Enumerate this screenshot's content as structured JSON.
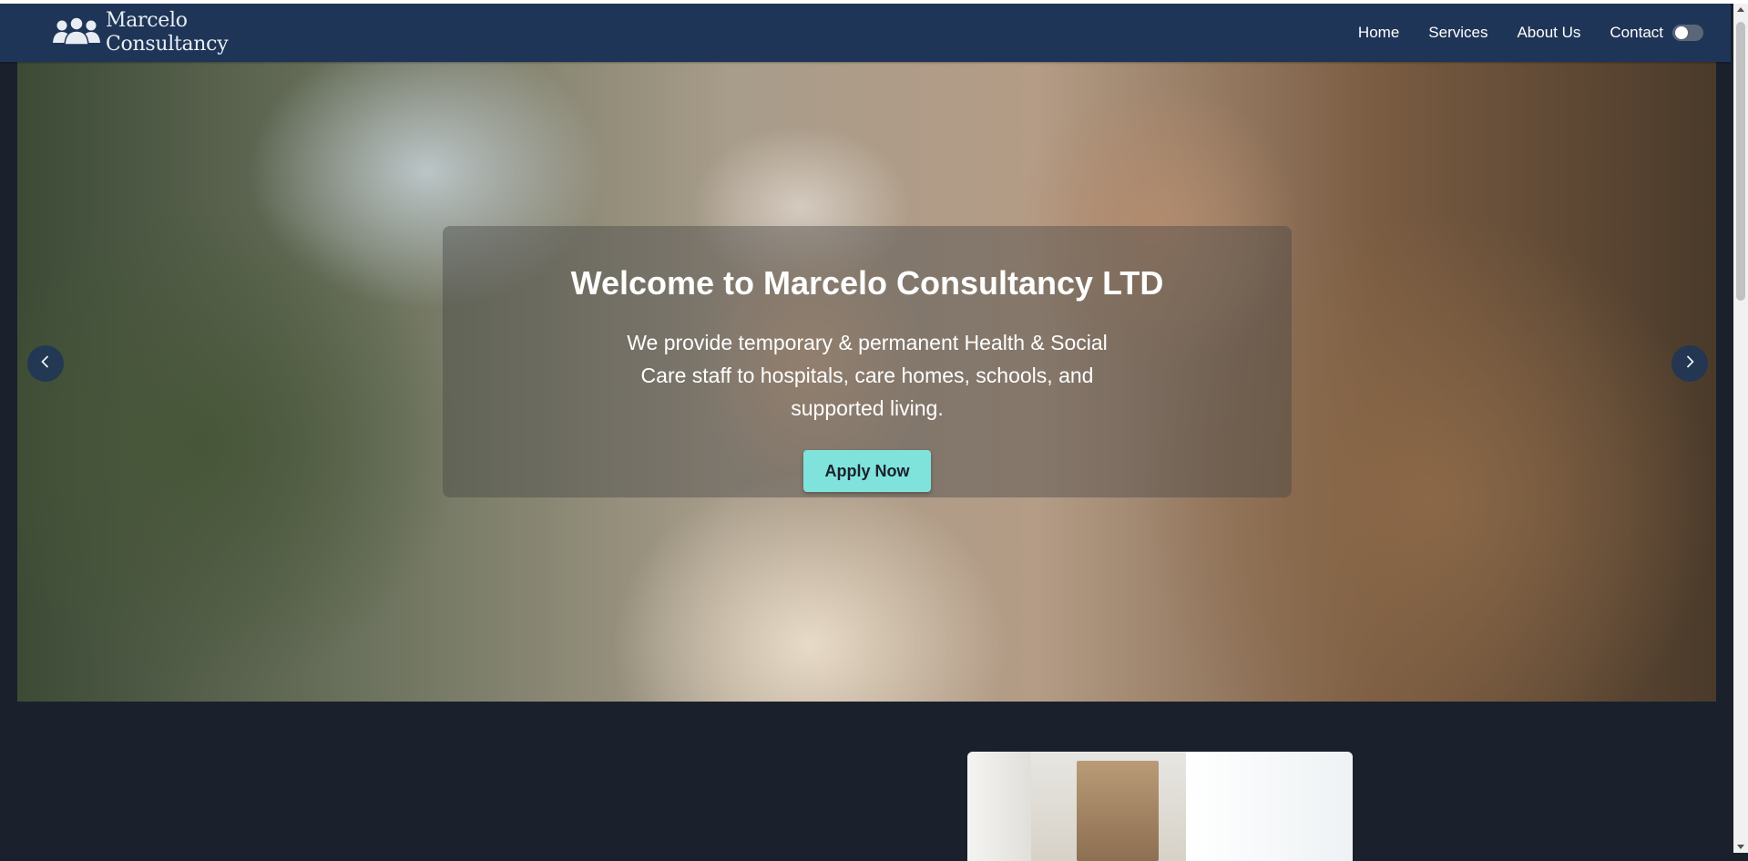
{
  "brand": {
    "name_line1": "Marcelo",
    "name_line2": "Consultancy",
    "logo_icon": "users-group-icon"
  },
  "nav": {
    "items": [
      {
        "label": "Home"
      },
      {
        "label": "Services"
      },
      {
        "label": "About Us"
      },
      {
        "label": "Contact"
      }
    ],
    "theme_toggle_icon": "toggle-switch"
  },
  "hero": {
    "title": "Welcome to Marcelo Consultancy LTD",
    "subtitle": "We provide temporary & permanent Health & Social Care staff to hospitals, care homes, schools, and supported living.",
    "cta_label": "Apply Now",
    "prev_icon": "chevron-left-icon",
    "next_icon": "chevron-right-icon"
  },
  "colors": {
    "navbar_bg": "#1f3557",
    "page_bg": "#1a202c",
    "cta_bg": "#7fe3db",
    "text_light": "#ffffff"
  }
}
